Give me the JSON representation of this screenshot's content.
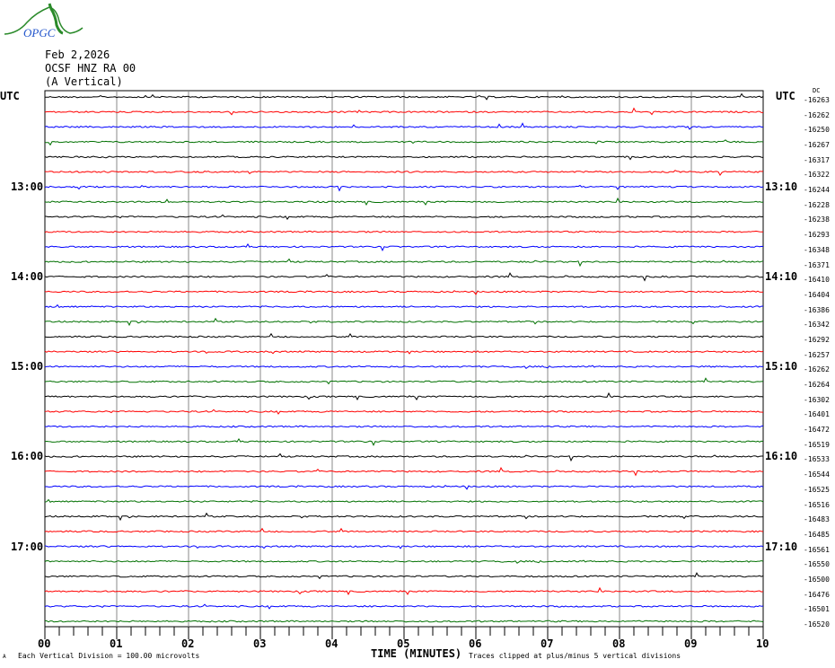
{
  "header": {
    "logo_text": "OPGC",
    "date": "Feb 2,2026",
    "station": "OCSF HNZ RA 00",
    "component": "(A Vertical)"
  },
  "chart_data": {
    "type": "line",
    "title": "OCSF HNZ RA 00 (A Vertical) Feb 2,2026",
    "xlabel": "TIME (MINUTES)",
    "xlim": [
      0,
      10
    ],
    "x_ticks": [
      "00",
      "01",
      "02",
      "03",
      "04",
      "05",
      "06",
      "07",
      "08",
      "09",
      "10"
    ],
    "left_axis_title": "UTC",
    "right_axis_title": "UTC",
    "dc_title": "DC",
    "left_hour_labels": [
      {
        "row": 6,
        "label": "13:00"
      },
      {
        "row": 12,
        "label": "14:00"
      },
      {
        "row": 18,
        "label": "15:00"
      },
      {
        "row": 24,
        "label": "16:00"
      },
      {
        "row": 30,
        "label": "17:00"
      }
    ],
    "right_hour_labels": [
      {
        "row": 6,
        "label": "13:10"
      },
      {
        "row": 12,
        "label": "14:10"
      },
      {
        "row": 18,
        "label": "15:10"
      },
      {
        "row": 24,
        "label": "16:10"
      },
      {
        "row": 30,
        "label": "17:10"
      }
    ],
    "trace_colors": [
      "#000000",
      "#ff0000",
      "#0000ff",
      "#007000"
    ],
    "dc_offsets": [
      "-16263",
      "-16262",
      "-16250",
      "-16267",
      "-16317",
      "-16322",
      "-16244",
      "-16228",
      "-16238",
      "-16293",
      "-16348",
      "-16371",
      "-16410",
      "-16404",
      "-16386",
      "-16342",
      "-16292",
      "-16257",
      "-16262",
      "-16264",
      "-16302",
      "-16401",
      "-16472",
      "-16519",
      "-16533",
      "-16544",
      "-16525",
      "-16516",
      "-16483",
      "-16485",
      "-16561",
      "-16550",
      "-16500",
      "-16476",
      "-16501",
      "-16520"
    ]
  },
  "footer": {
    "scale_note": "Each Vertical Division =  100.00 microvolts",
    "clip_note": "Traces clipped at plus/minus 5 vertical divisions",
    "corner_mark": "A"
  }
}
